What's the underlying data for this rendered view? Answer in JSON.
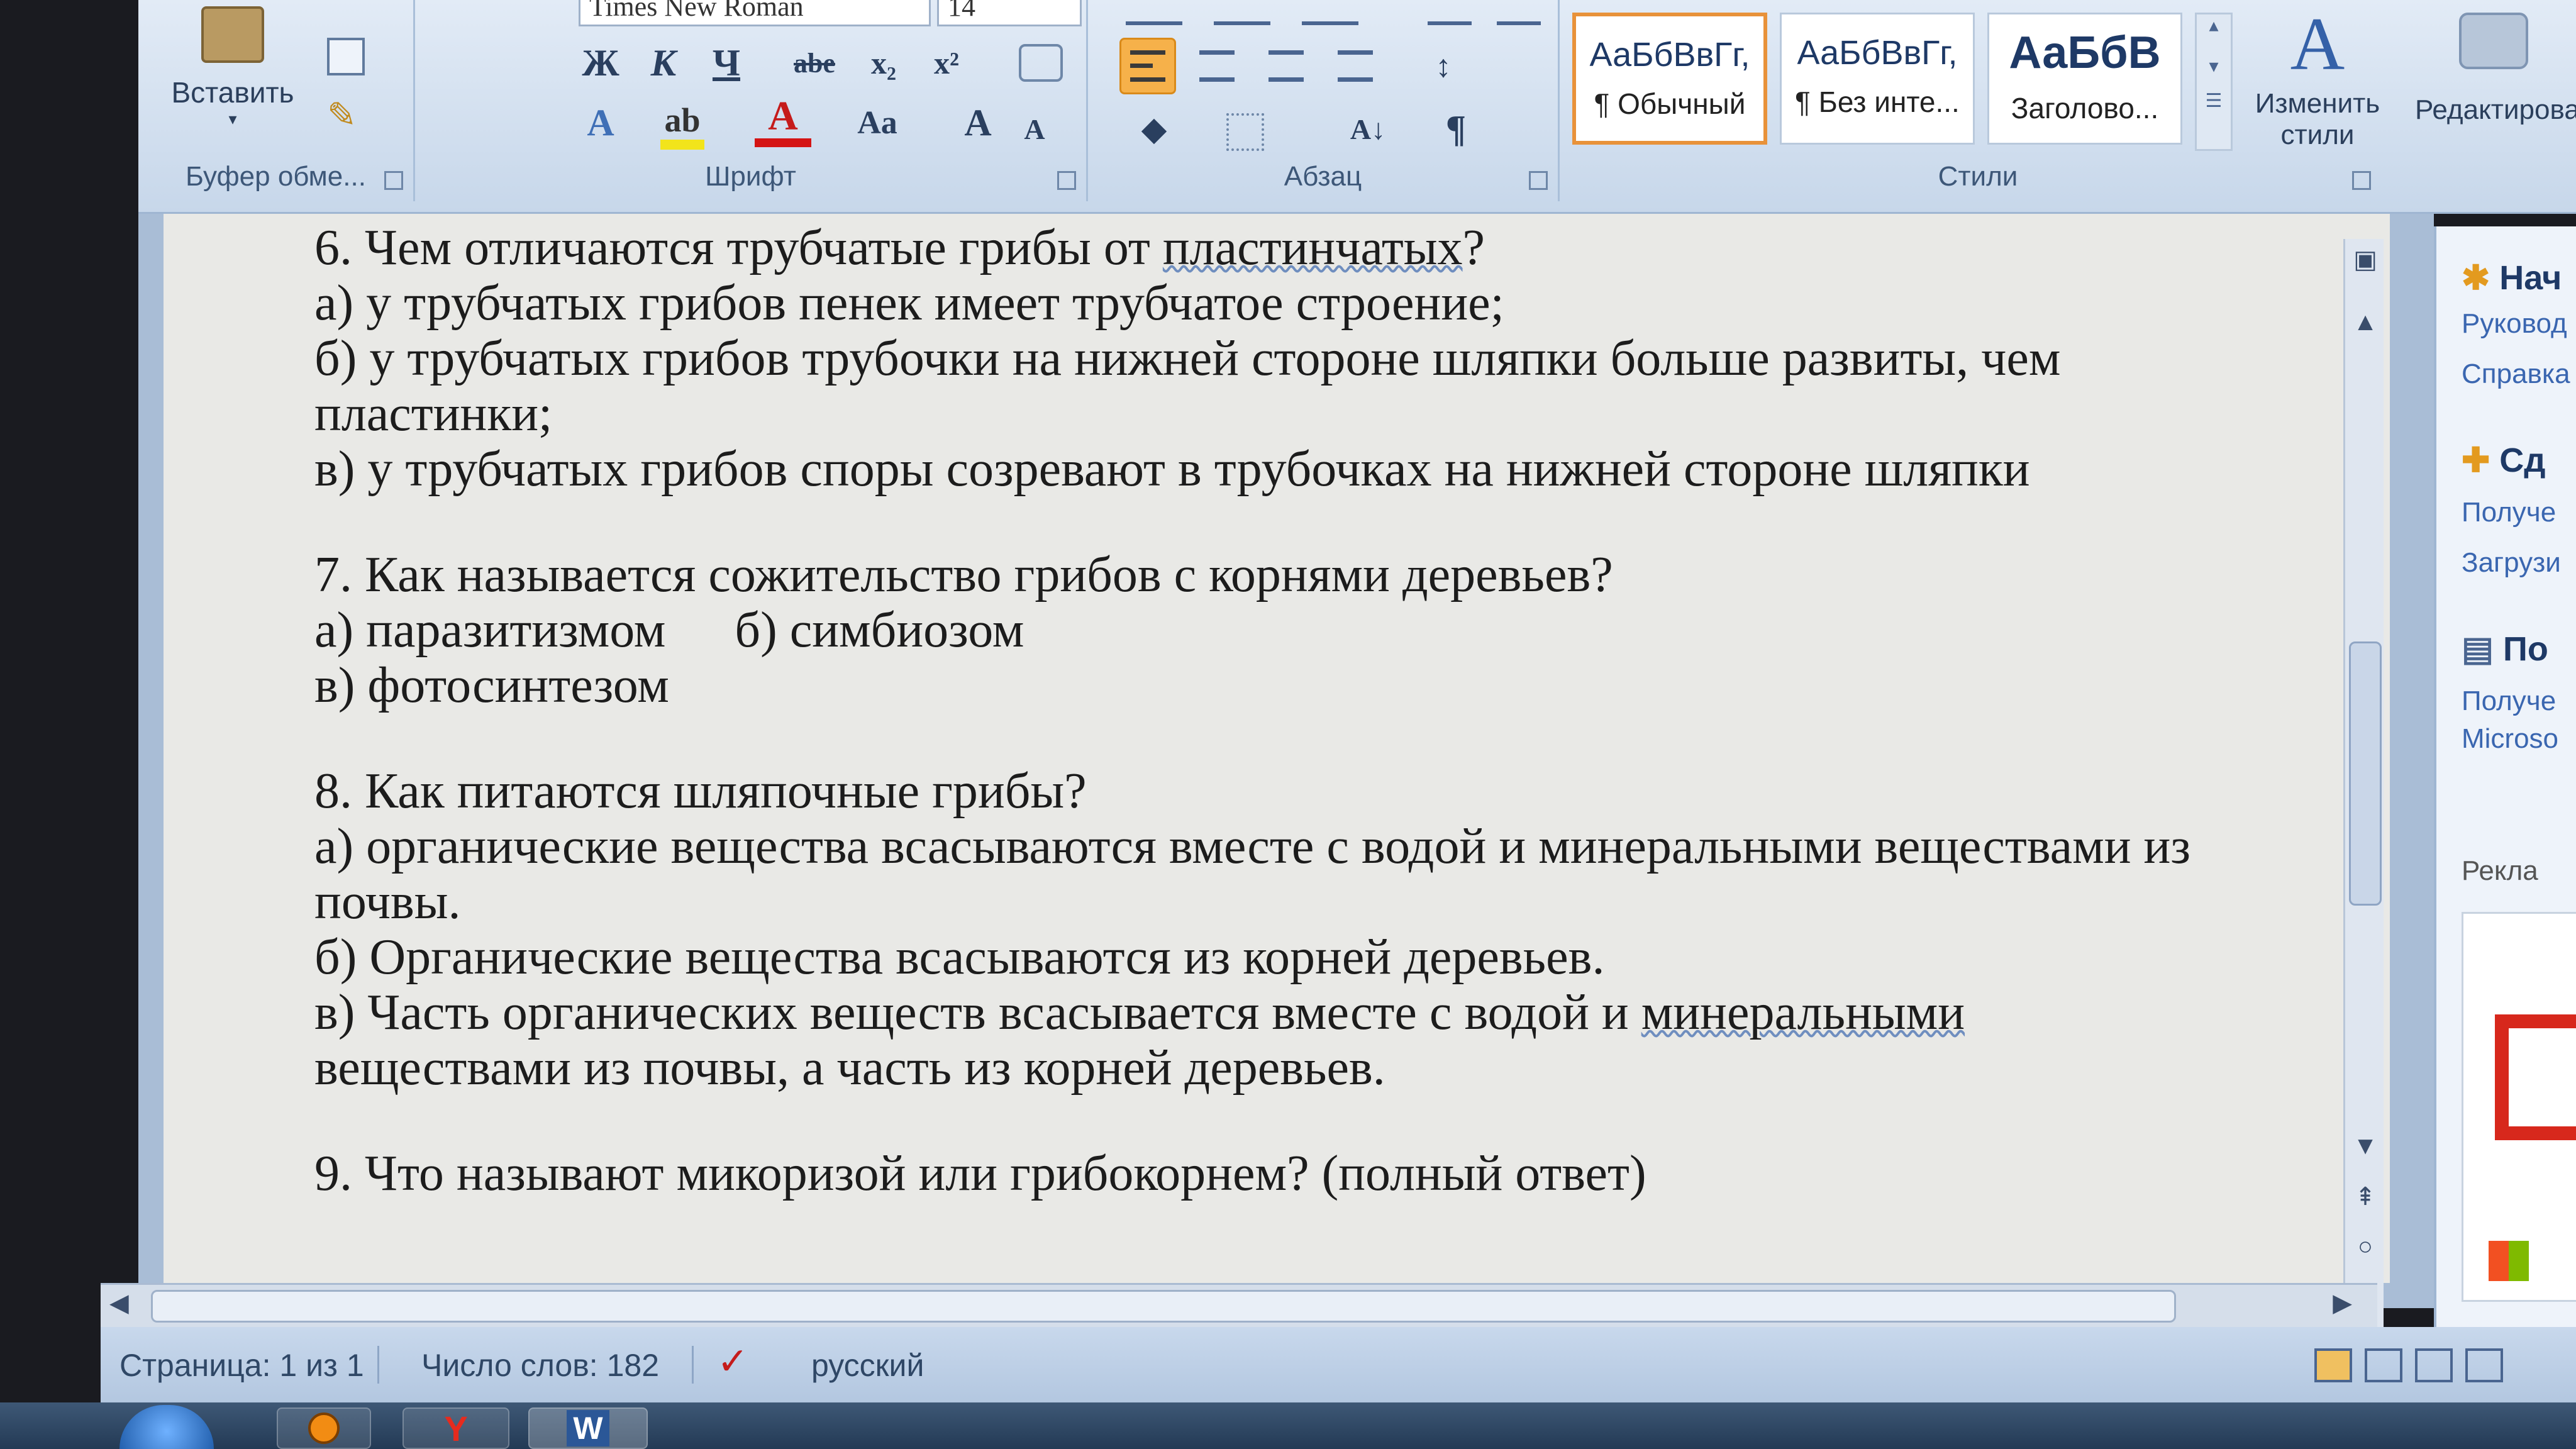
{
  "ribbon": {
    "clipboard": {
      "paste_label": "Вставить",
      "group_label": "Буфер обме..."
    },
    "font": {
      "font_name": "Times New Roman",
      "font_size": "14",
      "group_label": "Шрифт",
      "bold": "Ж",
      "italic": "К",
      "underline": "Ч",
      "strike": "abe",
      "subscript": "x₂",
      "superscript": "x²",
      "grow": "A",
      "shrink": "A",
      "case": "Aa",
      "font_color": "A"
    },
    "paragraph": {
      "group_label": "Абзац",
      "pilcrow": "¶"
    },
    "styles": {
      "group_label": "Стили",
      "tiles": [
        {
          "sample": "АаБбВвГг,",
          "name": "¶ Обычный"
        },
        {
          "sample": "АаБбВвГг,",
          "name": "¶ Без инте..."
        },
        {
          "sample": "АаБбВ",
          "name": "Заголово..."
        }
      ],
      "change_styles_line1": "Изменить",
      "change_styles_line2": "стили"
    },
    "editing": {
      "label": "Редактирование"
    }
  },
  "document": {
    "q6": {
      "question_pre": "6. Чем отличаются трубчатые грибы от ",
      "question_marked": "пластинчатых",
      "question_post": "?",
      "a": "а) у трубчатых грибов пенек имеет трубчатое строение;",
      "b1": "б) у трубчатых грибов трубочки на нижней стороне шляпки больше развиты, чем",
      "b2": "пластинки;",
      "c": "в) у трубчатых грибов споры созревают в трубочках на нижней стороне шляпки"
    },
    "q7": {
      "question": "7. Как называется сожительство грибов с корнями деревьев?",
      "a": "а) паразитизмом",
      "b": "б) симбиозом",
      "c": "в) фотосинтезом"
    },
    "q8": {
      "question": "8. Как питаются шляпочные грибы?",
      "a1": "а) органические вещества всасываются вместе с водой и минеральными веществами из",
      "a2": "почвы.",
      "b": "б) Органические вещества всасываются из корней деревьев.",
      "c1_pre": "в) Часть органических веществ всасывается вместе  с водой и ",
      "c1_marked": "минеральными",
      "c2": "веществами из почвы, а часть из корней   деревьев."
    },
    "q9": {
      "question": "9. Что называют микоризой или грибокорнем? (полный ответ)"
    }
  },
  "taskpane": {
    "heading1": "Нач",
    "link1": "Руковод",
    "link2": "Справка",
    "heading2": "Сд",
    "link3": "Получе",
    "link4": "Загрузи",
    "heading3": "По",
    "link5": "Получе",
    "link6": "Microso",
    "ad_label": "Рекла"
  },
  "statusbar": {
    "page": "Страница: 1 из 1",
    "words": "Число слов: 182",
    "language": "русский"
  },
  "taskbar": {
    "yandex_glyph": "Y",
    "word_glyph": "W"
  }
}
